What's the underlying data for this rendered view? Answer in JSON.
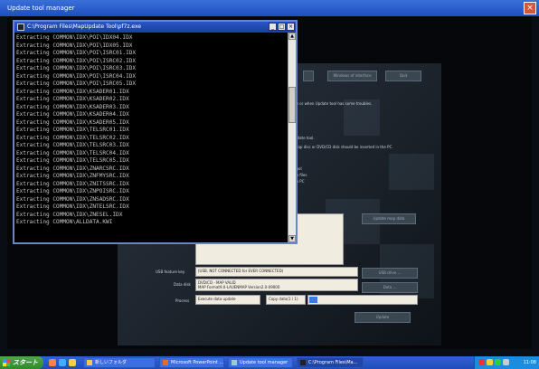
{
  "app_window": {
    "title": "Update tool manager",
    "close_glyph": "×"
  },
  "panel": {
    "buttons": {
      "top_left": "",
      "top_middle": "Windows of interface",
      "top_right": "Quit",
      "side_1": "Update map data",
      "side_2": "USB drive ...",
      "side_3": "Data ...",
      "update": "Update"
    },
    "notes": {
      "line1": "ry or when Update tool has some troubles.",
      "line2": "pdate tool.",
      "line3": "Map disc or DVD/CD disk should be inserted in the PC.",
      "line4": "tool",
      "line5": "te files",
      "line6": "to PC"
    },
    "usb_label": "USB feature key",
    "usb_value": "(USB, NOT CONNECTED for EVER CONNECTED)",
    "data_disk_label": "Data disk",
    "data_disk_value_1": "DVD/CD - MAP VALID",
    "data_disk_value_2": "MAP Format9.0-LAUENMAP Version2.0-09000",
    "process_label": "Process",
    "process_step": "Execute data update",
    "process_detail": "Copy data(1 / 1)",
    "progress_fraction": 0.08
  },
  "console": {
    "title": "C:\\Program Files\\MapUpdate Tool\\pf7z.exe",
    "lines": [
      "Extracting  COMMON\\IDX\\POI\\IDX04.IDX",
      "Extracting  COMMON\\IDX\\POI\\IDX05.IDX",
      "Extracting  COMMON\\IDX\\POI\\ISRC01.IDX",
      "Extracting  COMMON\\IDX\\POI\\ISRC02.IDX",
      "Extracting  COMMON\\IDX\\POI\\ISRC03.IDX",
      "Extracting  COMMON\\IDX\\POI\\ISRC04.IDX",
      "Extracting  COMMON\\IDX\\POI\\ISRC05.IDX",
      "Extracting  COMMON\\IDX\\KSADER01.IDX",
      "Extracting  COMMON\\IDX\\KSADER02.IDX",
      "Extracting  COMMON\\IDX\\KSADER03.IDX",
      "Extracting  COMMON\\IDX\\KSADER04.IDX",
      "Extracting  COMMON\\IDX\\KSADER05.IDX",
      "Extracting  COMMON\\IDX\\TELSRC01.IDX",
      "Extracting  COMMON\\IDX\\TELSRC02.IDX",
      "Extracting  COMMON\\IDX\\TELSRC03.IDX",
      "Extracting  COMMON\\IDX\\TELSRC04.IDX",
      "Extracting  COMMON\\IDX\\TELSRC05.IDX",
      "Extracting  COMMON\\IDX\\ZNARCSRC.IDX",
      "Extracting  COMMON\\IDX\\ZNFMYSRC.IDX",
      "Extracting  COMMON\\IDX\\ZNITSSRC.IDX",
      "Extracting  COMMON\\IDX\\ZNPOISRC.IDX",
      "Extracting  COMMON\\IDX\\ZNSADSRC.IDX",
      "Extracting  COMMON\\IDX\\ZNTELSRC.IDX",
      "Extracting  COMMON\\IDX\\ZNESEL.IDX",
      "Extracting  COMMON\\ALLDATA.KWI"
    ]
  },
  "taskbar": {
    "start_label": "スタート",
    "buttons": [
      "新しいフォルダ",
      "Microsoft PowerPoint ...",
      "Update tool manager",
      "C:\\Program Files\\Ma..."
    ],
    "clock": "11:08"
  }
}
